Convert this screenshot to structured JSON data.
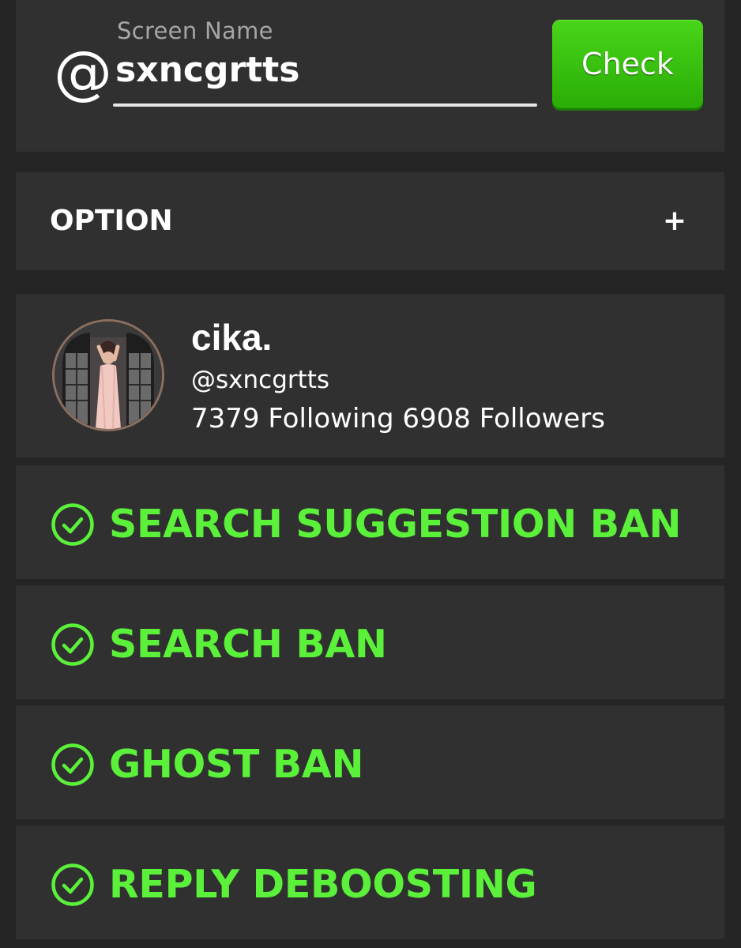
{
  "search": {
    "at_symbol": "@",
    "label": "Screen Name",
    "value": "sxncgrtts",
    "check_button": "Check"
  },
  "option": {
    "label": "OPTION",
    "toggle": "+"
  },
  "profile": {
    "display_name": "cika.",
    "handle": "@sxncgrtts",
    "stats": "7379 Following 6908 Followers"
  },
  "results": [
    {
      "label": "SEARCH SUGGESTION BAN",
      "icon": "check-circle-icon",
      "status_color": "#5bf03a"
    },
    {
      "label": "SEARCH BAN",
      "icon": "check-circle-icon",
      "status_color": "#5bf03a"
    },
    {
      "label": "GHOST BAN",
      "icon": "check-circle-icon",
      "status_color": "#5bf03a"
    },
    {
      "label": "REPLY DEBOOSTING",
      "icon": "check-circle-icon",
      "status_color": "#5bf03a"
    }
  ],
  "colors": {
    "background": "#252525",
    "card": "#303030",
    "accent_green": "#5bf03a",
    "button_green": "#3cc412"
  }
}
